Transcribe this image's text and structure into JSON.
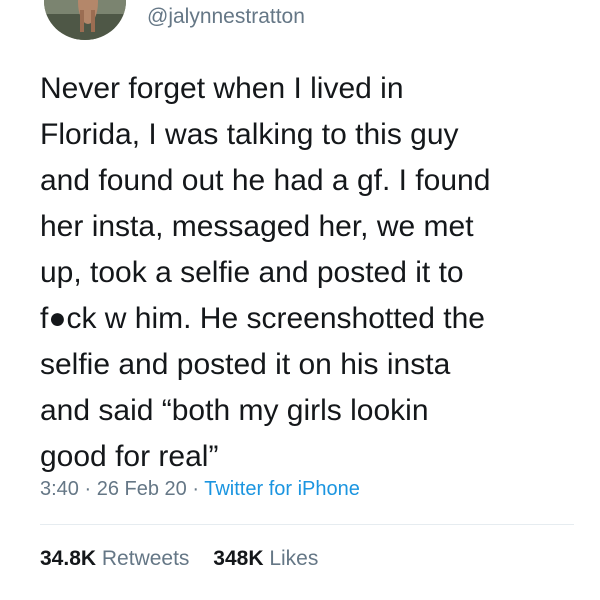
{
  "tweet": {
    "handle": "@jalynnestratton",
    "text_lines": [
      "Never forget when I lived in",
      "Florida, I was talking to this guy",
      "and found out he had a gf. I found",
      "her insta, messaged her, we met",
      "up, took a selfie and posted it to",
      "f●ck w him. He screenshotted the",
      "selfie and posted it on his insta",
      "and said “both my girls lookin",
      "good for real”"
    ],
    "time": "3:40",
    "date": "26 Feb 20",
    "source": "Twitter for iPhone",
    "separator": "·"
  },
  "stats": {
    "retweets_count": "34.8K",
    "retweets_label": "Retweets",
    "likes_count": "348K",
    "likes_label": "Likes"
  },
  "colors": {
    "text": "#14171a",
    "secondary": "#657786",
    "link": "#1b95e0",
    "divider": "#e6ecf0"
  },
  "icons": {
    "avatar": "profile-photo"
  }
}
